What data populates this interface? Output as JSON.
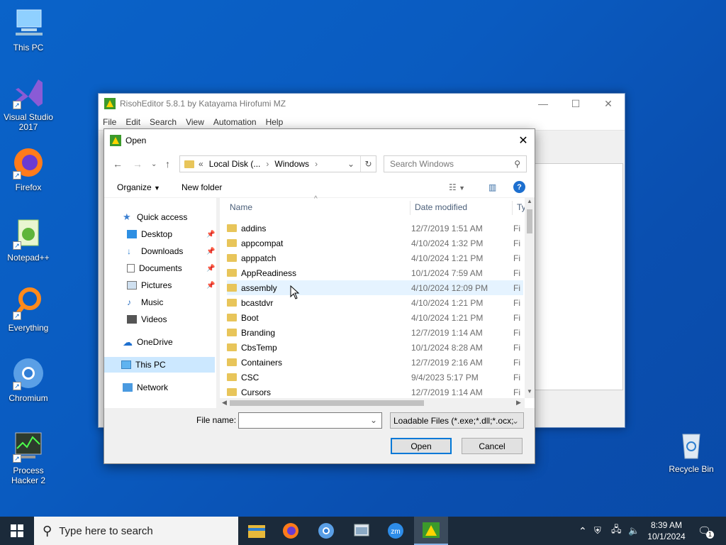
{
  "desktop": {
    "icons": [
      {
        "label": "This PC"
      },
      {
        "label": "Visual Studio 2017"
      },
      {
        "label": "Firefox"
      },
      {
        "label": "Notepad++"
      },
      {
        "label": "Everything"
      },
      {
        "label": "Chromium"
      },
      {
        "label": "Process Hacker 2"
      },
      {
        "label": "Recycle Bin"
      }
    ]
  },
  "editor": {
    "title": "RisohEditor 5.8.1 by Katayama Hirofumi MZ",
    "menu": [
      "File",
      "Edit",
      "Search",
      "View",
      "Automation",
      "Help"
    ]
  },
  "dialog": {
    "title": "Open",
    "address": {
      "prefix": "«",
      "seg1": "Local Disk (...",
      "seg2": "Windows"
    },
    "search_placeholder": "Search Windows",
    "toolbar": {
      "organize": "Organize",
      "new_folder": "New folder"
    },
    "nav": {
      "quick_access": "Quick access",
      "desktop": "Desktop",
      "downloads": "Downloads",
      "documents": "Documents",
      "pictures": "Pictures",
      "music": "Music",
      "videos": "Videos",
      "onedrive": "OneDrive",
      "this_pc": "This PC",
      "network": "Network"
    },
    "columns": {
      "name": "Name",
      "date": "Date modified",
      "type": "Ty"
    },
    "files": [
      {
        "name": "addins",
        "date": "12/7/2019 1:51 AM",
        "type": "Fi"
      },
      {
        "name": "appcompat",
        "date": "4/10/2024 1:32 PM",
        "type": "Fi"
      },
      {
        "name": "apppatch",
        "date": "4/10/2024 1:21 PM",
        "type": "Fi"
      },
      {
        "name": "AppReadiness",
        "date": "10/1/2024 7:59 AM",
        "type": "Fi"
      },
      {
        "name": "assembly",
        "date": "4/10/2024 12:09 PM",
        "type": "Fi"
      },
      {
        "name": "bcastdvr",
        "date": "4/10/2024 1:21 PM",
        "type": "Fi"
      },
      {
        "name": "Boot",
        "date": "4/10/2024 1:21 PM",
        "type": "Fi"
      },
      {
        "name": "Branding",
        "date": "12/7/2019 1:14 AM",
        "type": "Fi"
      },
      {
        "name": "CbsTemp",
        "date": "10/1/2024 8:28 AM",
        "type": "Fi"
      },
      {
        "name": "Containers",
        "date": "12/7/2019 2:16 AM",
        "type": "Fi"
      },
      {
        "name": "CSC",
        "date": "9/4/2023 5:17 PM",
        "type": "Fi"
      },
      {
        "name": "Cursors",
        "date": "12/7/2019 1:14 AM",
        "type": "Fi"
      }
    ],
    "file_name_label": "File name:",
    "file_name_value": "",
    "file_type": "Loadable Files (*.exe;*.dll;*.ocx;",
    "open_button": "Open",
    "cancel_button": "Cancel"
  },
  "taskbar": {
    "search_placeholder": "Type here to search",
    "time": "8:39 AM",
    "date": "10/1/2024",
    "notification_count": "1"
  }
}
